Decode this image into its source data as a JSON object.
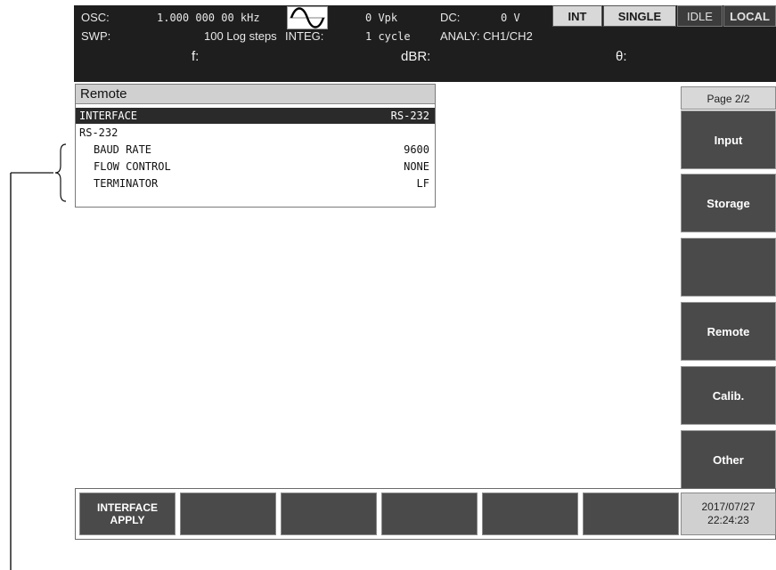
{
  "status": {
    "osc_label": "OSC:",
    "osc_freq": "1.000 000 00 kHz",
    "amp_value": "0 Vpk",
    "dc_label": "DC:",
    "dc_value": "0 V",
    "swp_label": "SWP:",
    "swp_value": "100 Log steps",
    "integ_label": "INTEG:",
    "integ_value": "1 cycle",
    "analy": "ANALY: CH1/CH2",
    "f_label": "f:",
    "dbr_label": "dBR:",
    "theta_label": "θ:",
    "buttons": {
      "int": "INT",
      "single": "SINGLE",
      "idle": "IDLE",
      "local": "LOCAL"
    },
    "waveform_icon": "sine-wave-icon"
  },
  "remote_panel": {
    "title": "Remote",
    "rows": [
      {
        "label": "INTERFACE",
        "value": "RS-232"
      },
      {
        "label": "RS-232",
        "value": ""
      },
      {
        "label": "BAUD RATE",
        "value": "9600"
      },
      {
        "label": "FLOW CONTROL",
        "value": "NONE"
      },
      {
        "label": "TERMINATOR",
        "value": "LF"
      }
    ]
  },
  "side_menu": {
    "page_indicator": "Page 2/2",
    "keys": [
      "Input",
      "Storage",
      "",
      "Remote",
      "Calib.",
      "Other"
    ]
  },
  "bottom_menu": {
    "apply_line1": "INTERFACE",
    "apply_line2": "APPLY"
  },
  "datetime": {
    "date": "2017/07/27",
    "time": "22:24:23"
  },
  "colors": {
    "bar_dark": "#1e1e1e",
    "key_gray": "#4a4a4a",
    "selected_row": "#2a2a2a"
  }
}
